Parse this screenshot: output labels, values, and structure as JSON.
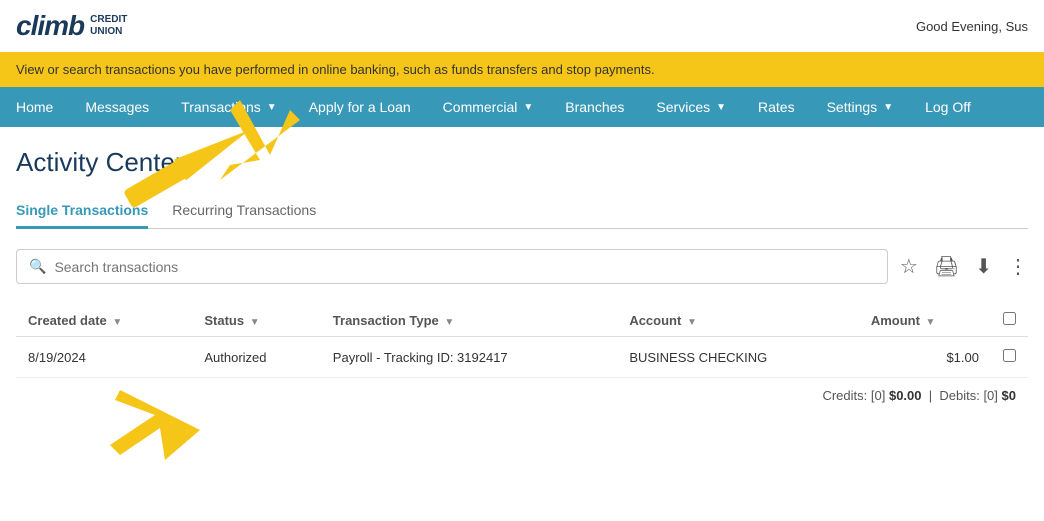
{
  "header": {
    "logo_text": "climb",
    "logo_sub": "CREDIT\nUNION",
    "greeting": "Good Evening, Sus"
  },
  "alert": {
    "message": "View or search transactions you have performed in online banking, such as funds transfers and stop payments."
  },
  "nav": {
    "items": [
      {
        "label": "Home",
        "has_dropdown": false
      },
      {
        "label": "Messages",
        "has_dropdown": false
      },
      {
        "label": "Transactions",
        "has_dropdown": true
      },
      {
        "label": "Apply for a Loan",
        "has_dropdown": false
      },
      {
        "label": "Commercial",
        "has_dropdown": true
      },
      {
        "label": "Branches",
        "has_dropdown": false
      },
      {
        "label": "Services",
        "has_dropdown": true
      },
      {
        "label": "Rates",
        "has_dropdown": false
      },
      {
        "label": "Settings",
        "has_dropdown": true
      },
      {
        "label": "Log Off",
        "has_dropdown": false
      }
    ]
  },
  "page": {
    "title": "Activity Center"
  },
  "tabs": [
    {
      "label": "Single Transactions",
      "active": true
    },
    {
      "label": "Recurring Transactions",
      "active": false
    }
  ],
  "search": {
    "placeholder": "Search transactions",
    "value": ""
  },
  "table": {
    "columns": [
      {
        "label": "Created date",
        "has_sort": true
      },
      {
        "label": "Status",
        "has_sort": true
      },
      {
        "label": "Transaction Type",
        "has_sort": true
      },
      {
        "label": "Account",
        "has_sort": true
      },
      {
        "label": "Amount",
        "has_sort": true
      },
      {
        "label": "select_all",
        "is_checkbox": true
      }
    ],
    "rows": [
      {
        "created_date": "8/19/2024",
        "status": "Authorized",
        "transaction_type": "Payroll - Tracking ID: 3192417",
        "account": "BUSINESS CHECKING",
        "amount": "$1.00"
      }
    ]
  },
  "footer": {
    "credits_label": "Credits:",
    "credits_count": "[0]",
    "credits_value": "$0.00",
    "debits_label": "Debits:",
    "debits_count": "[0]",
    "debits_value": "$0"
  }
}
